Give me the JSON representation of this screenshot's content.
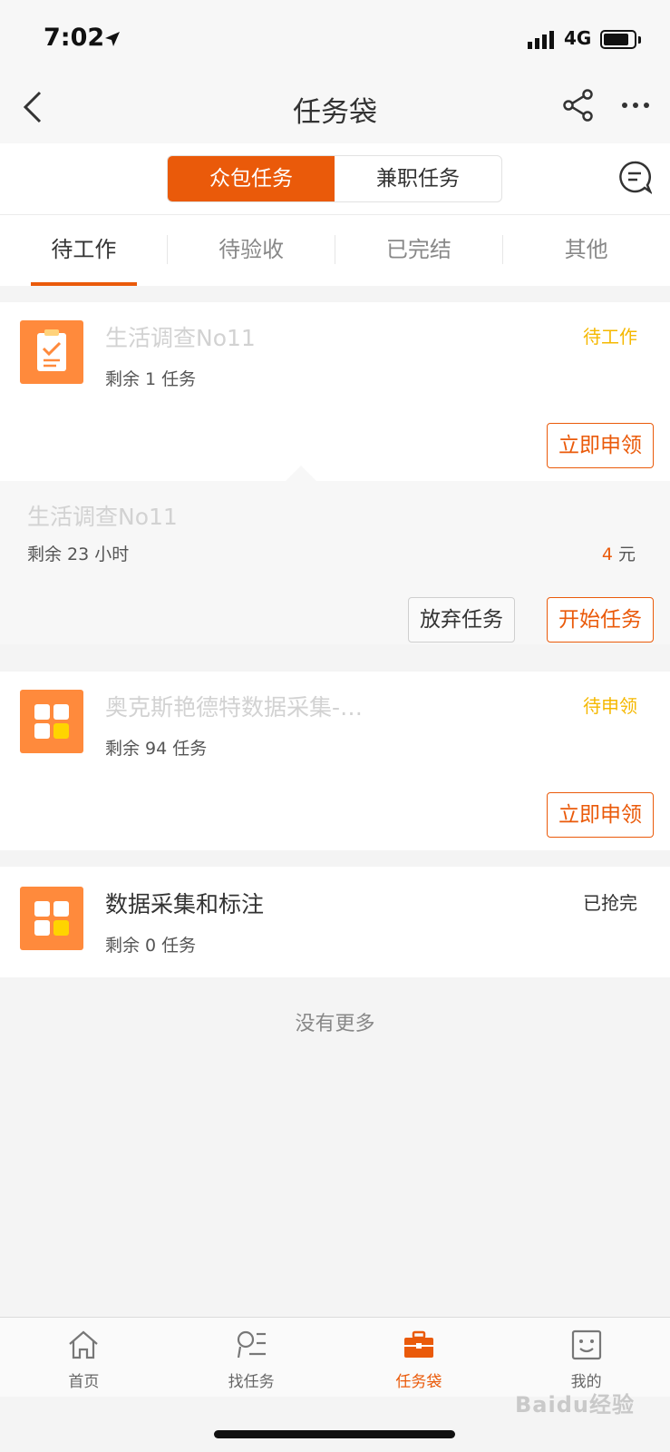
{
  "status_bar": {
    "time": "7:02",
    "network": "4G"
  },
  "nav": {
    "title": "任务袋"
  },
  "segment": {
    "items": [
      "众包任务",
      "兼职任务"
    ],
    "active": 0
  },
  "subtabs": {
    "items": [
      "待工作",
      "待验收",
      "已完结",
      "其他"
    ],
    "active": 0
  },
  "cards": [
    {
      "title": "生活调查No11",
      "remaining": "剩余 1 任务",
      "status": "待工作",
      "action": "立即申领"
    },
    {
      "title": "奥克斯艳德特数据采集-…",
      "remaining": "剩余 94 任务",
      "status": "待申领",
      "action": "立即申领"
    },
    {
      "title": "数据采集和标注",
      "remaining": "剩余 0 任务",
      "status": "已抢完"
    }
  ],
  "detail": {
    "title": "生活调查No11",
    "remaining": "剩余 23 小时",
    "price_value": "4",
    "price_unit": " 元",
    "abandon": "放弃任务",
    "start": "开始任务"
  },
  "footer": {
    "no_more": "没有更多"
  },
  "tabbar": {
    "items": [
      {
        "label": "首页",
        "icon": "home-icon"
      },
      {
        "label": "找任务",
        "icon": "find-task-icon"
      },
      {
        "label": "任务袋",
        "icon": "task-bag-icon"
      },
      {
        "label": "我的",
        "icon": "profile-icon"
      }
    ],
    "active": 2
  },
  "watermark": "Baidu经验",
  "colors": {
    "accent": "#ea5a0a",
    "icon_bg": "#ff8a3c",
    "status_yellow": "#f5b800"
  }
}
